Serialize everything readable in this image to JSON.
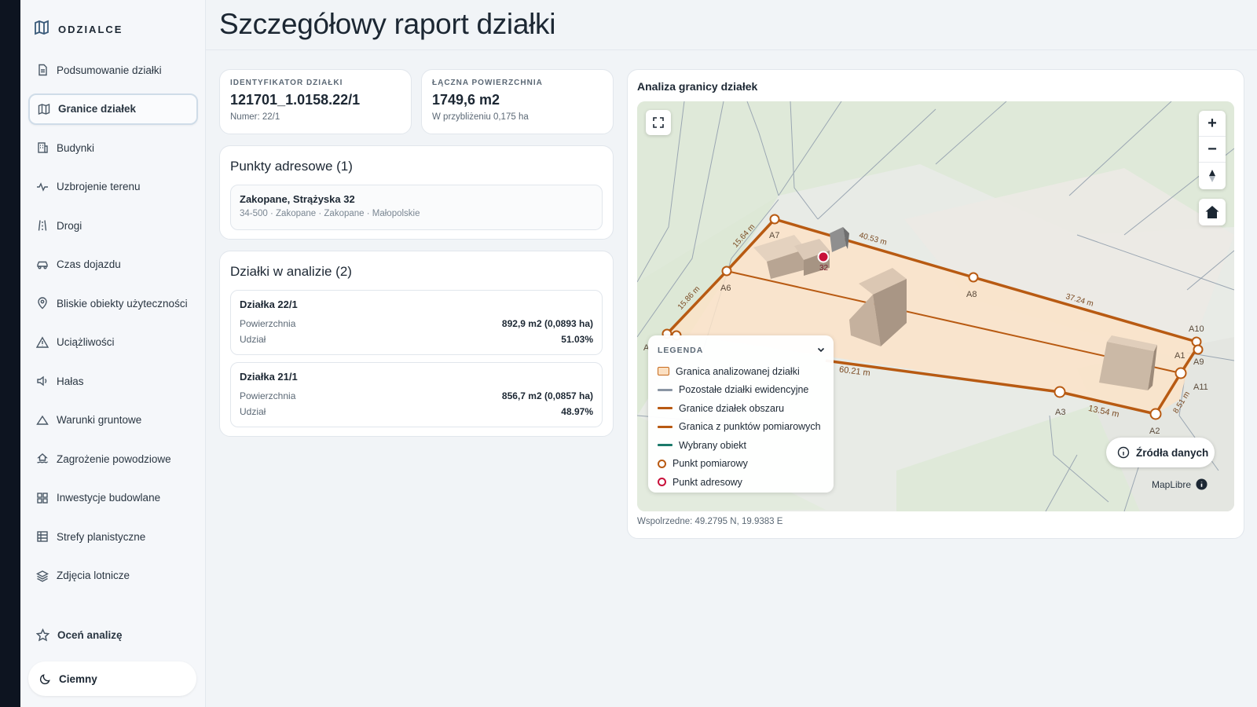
{
  "brand": {
    "name": "ODZIALCE"
  },
  "sidebar": {
    "items": [
      {
        "label": "Podsumowanie działki",
        "icon": "document-icon"
      },
      {
        "label": "Granice działek",
        "icon": "map-icon",
        "active": true
      },
      {
        "label": "Budynki",
        "icon": "building-icon"
      },
      {
        "label": "Uzbrojenie terenu",
        "icon": "pulse-icon"
      },
      {
        "label": "Drogi",
        "icon": "road-icon"
      },
      {
        "label": "Czas dojazdu",
        "icon": "car-icon"
      },
      {
        "label": "Bliskie obiekty użyteczności",
        "icon": "pin-icon"
      },
      {
        "label": "Uciążliwości",
        "icon": "warning-icon"
      },
      {
        "label": "Hałas",
        "icon": "speaker-icon"
      },
      {
        "label": "Warunki gruntowe",
        "icon": "terrain-icon"
      },
      {
        "label": "Zagrożenie powodziowe",
        "icon": "flood-icon"
      },
      {
        "label": "Inwestycje budowlane",
        "icon": "grid-icon"
      },
      {
        "label": "Strefy planistyczne",
        "icon": "table-icon"
      },
      {
        "label": "Zdjęcia lotnicze",
        "icon": "layers-icon"
      }
    ],
    "rate_label": "Oceń analizę",
    "theme_label": "Ciemny"
  },
  "page": {
    "title": "Szczegółowy raport działki"
  },
  "stats": {
    "id_label": "IDENTYFIKATOR DZIAŁKI",
    "id_value": "121701_1.0158.22/1",
    "id_sub": "Numer: 22/1",
    "area_label": "ŁĄCZNA POWIERZCHNIA",
    "area_value": "1749,6 m2",
    "area_sub": "W przybliżeniu 0,175 ha"
  },
  "addresses": {
    "title": "Punkty adresowe (1)",
    "items": [
      {
        "title": "Zakopane, Strążyska 32",
        "sub": "34-500 · Zakopane · Zakopane · Małopolskie"
      }
    ]
  },
  "parcels": {
    "title": "Działki w analizie (2)",
    "area_key": "Powierzchnia",
    "share_key": "Udział",
    "items": [
      {
        "name": "Działka 22/1",
        "area": "892,9 m2 (0,0893 ha)",
        "share": "51.03%"
      },
      {
        "name": "Działka 21/1",
        "area": "856,7 m2 (0,0857 ha)",
        "share": "48.97%"
      }
    ]
  },
  "map": {
    "title": "Analiza granicy działek",
    "points": {
      "A1": "A1",
      "A2": "A2",
      "A3": "A3",
      "A6": "A6",
      "A7": "A7",
      "A8": "A8",
      "A9": "A9",
      "A10": "A10",
      "A11": "A11",
      "A_left": "A"
    },
    "dimensions": {
      "d1": "15.64 m",
      "d2": "40.53 m",
      "d3": "15.86 m",
      "d4": "37.24 m",
      "d5": "60.21 m",
      "d6": "13.54 m",
      "d7": "8.51 m"
    },
    "address_number": "32",
    "zoom_in": "+",
    "zoom_out": "−",
    "legend": {
      "title": "LEGENDA",
      "items": [
        {
          "label": "Granica analizowanej działki"
        },
        {
          "label": "Pozostałe działki ewidencyjne"
        },
        {
          "label": "Granice działek obszaru"
        },
        {
          "label": "Granica z punktów pomiarowych"
        },
        {
          "label": "Wybrany obiekt"
        },
        {
          "label": "Punkt pomiarowy"
        },
        {
          "label": "Punkt adresowy"
        }
      ]
    },
    "sources_label": "Źródła danych",
    "attribution": "MapLibre",
    "coords": "Wspolrzedne: 49.2795 N, 19.9383 E"
  },
  "colors": {
    "accent": "#b85a12",
    "parcel_fill": "#fbe3c8",
    "address_point": "#c8113a",
    "selected_object": "#1b7a6a",
    "other_parcels": "#8a96a3"
  }
}
